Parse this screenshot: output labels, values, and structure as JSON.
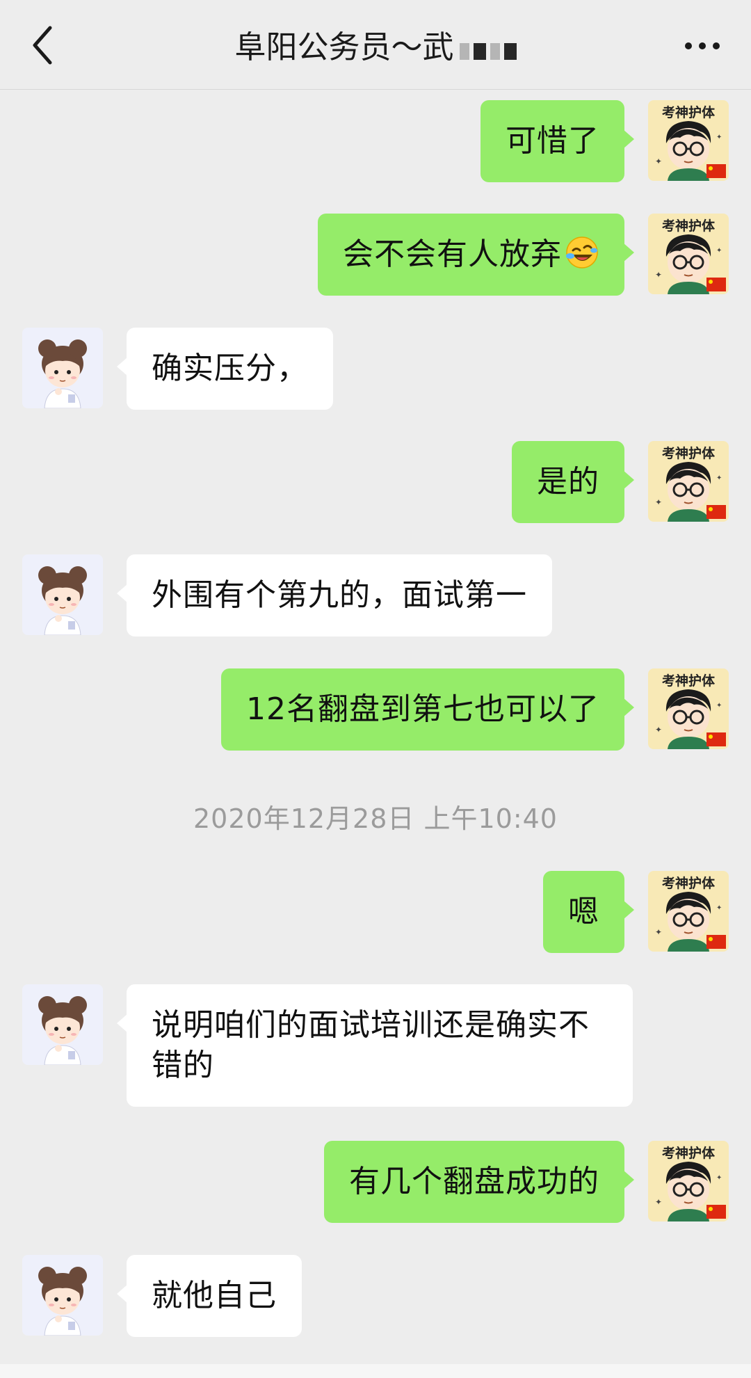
{
  "nav": {
    "title": "阜阳公务员～武",
    "back_icon": "chevron-left-icon",
    "more_icon": "more-dots-icon"
  },
  "messages": [
    {
      "side": "out",
      "text": "可惜了"
    },
    {
      "side": "out",
      "text": "会不会有人放弃",
      "emoji": "rolling-laughing-emoji"
    },
    {
      "side": "in",
      "text": "确实压分，"
    },
    {
      "side": "out",
      "text": "是的"
    },
    {
      "side": "in",
      "text": "外围有个第九的，面试第一"
    },
    {
      "side": "out",
      "text": "12名翻盘到第七也可以了"
    },
    {
      "side": "out",
      "text": "嗯"
    },
    {
      "side": "in",
      "text": "说明咱们的面试培训还是确实不错的"
    },
    {
      "side": "out",
      "text": "有几个翻盘成功的"
    },
    {
      "side": "in",
      "text": "就他自己"
    }
  ],
  "timestamp": "2020年12月28日 上午10:40",
  "avatars": {
    "self_badge_text": "考神护体",
    "self_icon": "cartoon-boy-glasses-avatar",
    "other_icon": "cartoon-girl-buns-avatar"
  },
  "colors": {
    "background": "#ededed",
    "outgoing_bubble": "#95ec69",
    "incoming_bubble": "#ffffff",
    "timestamp_text": "#9b9b9b"
  }
}
